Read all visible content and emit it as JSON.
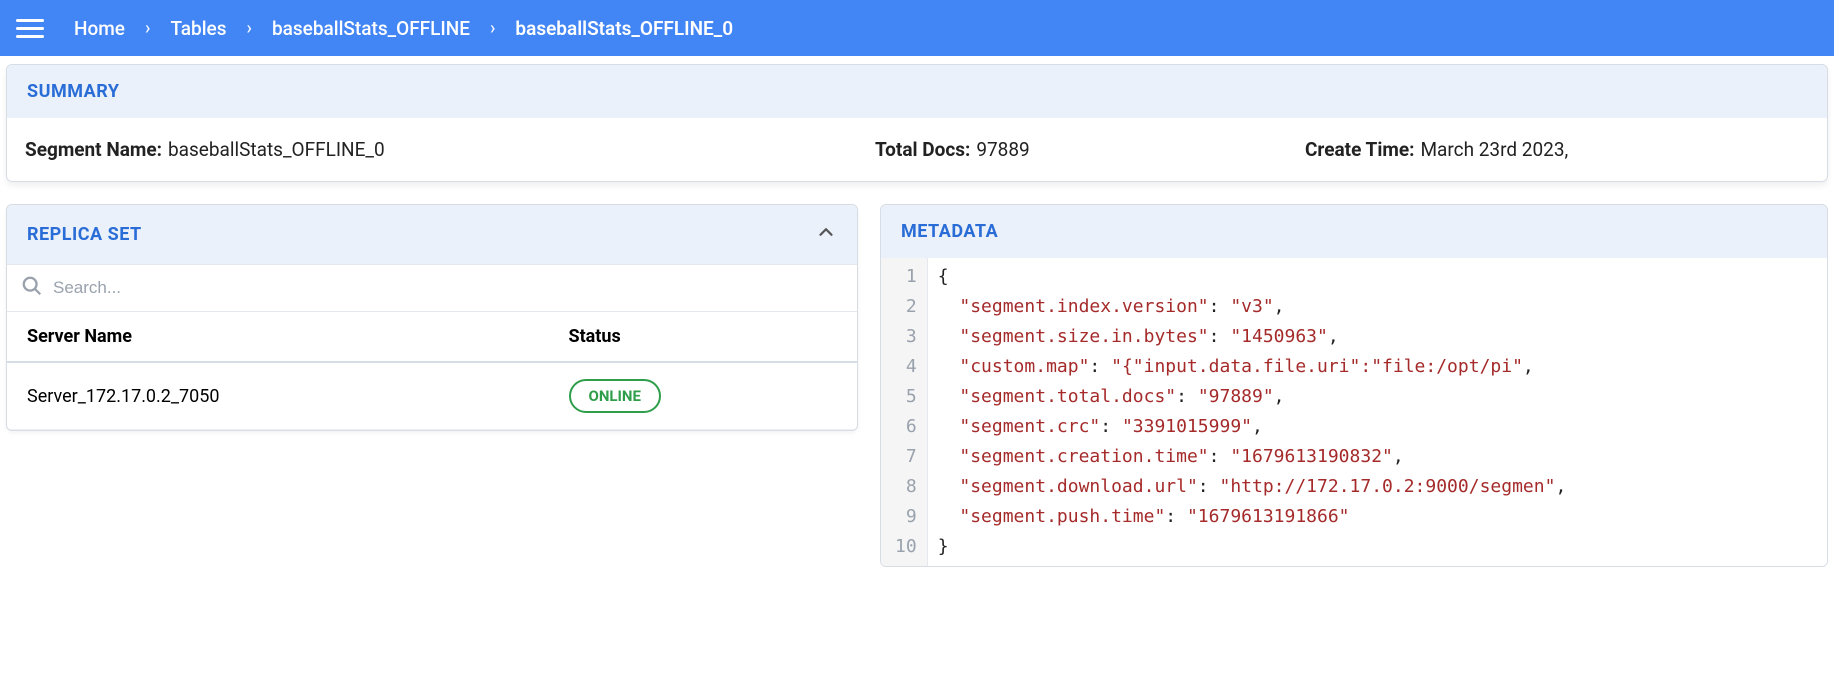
{
  "breadcrumb": {
    "items": [
      {
        "label": "Home"
      },
      {
        "label": "Tables"
      },
      {
        "label": "baseballStats_OFFLINE"
      },
      {
        "label": "baseballStats_OFFLINE_0"
      }
    ]
  },
  "summary": {
    "header": "SUMMARY",
    "segment_label": "Segment Name:",
    "segment_value": "baseballStats_OFFLINE_0",
    "total_docs_label": "Total Docs:",
    "total_docs_value": "97889",
    "create_time_label": "Create Time:",
    "create_time_value": "March 23rd 2023,"
  },
  "replica": {
    "header": "REPLICA SET",
    "search_placeholder": "Search...",
    "columns": {
      "server": "Server Name",
      "status": "Status"
    },
    "rows": [
      {
        "server": "Server_172.17.0.2_7050",
        "status": "ONLINE"
      }
    ]
  },
  "metadata": {
    "header": "METADATA",
    "json": {
      "segment.index.version": "v3",
      "segment.size.in.bytes": "1450963",
      "custom.map": "{\"input.data.file.uri\":\"file:/opt/pi",
      "segment.total.docs": "97889",
      "segment.crc": "3391015999",
      "segment.creation.time": "1679613190832",
      "segment.download.url": "http://172.17.0.2:9000/segmen",
      "segment.push.time": "1679613191866"
    }
  }
}
